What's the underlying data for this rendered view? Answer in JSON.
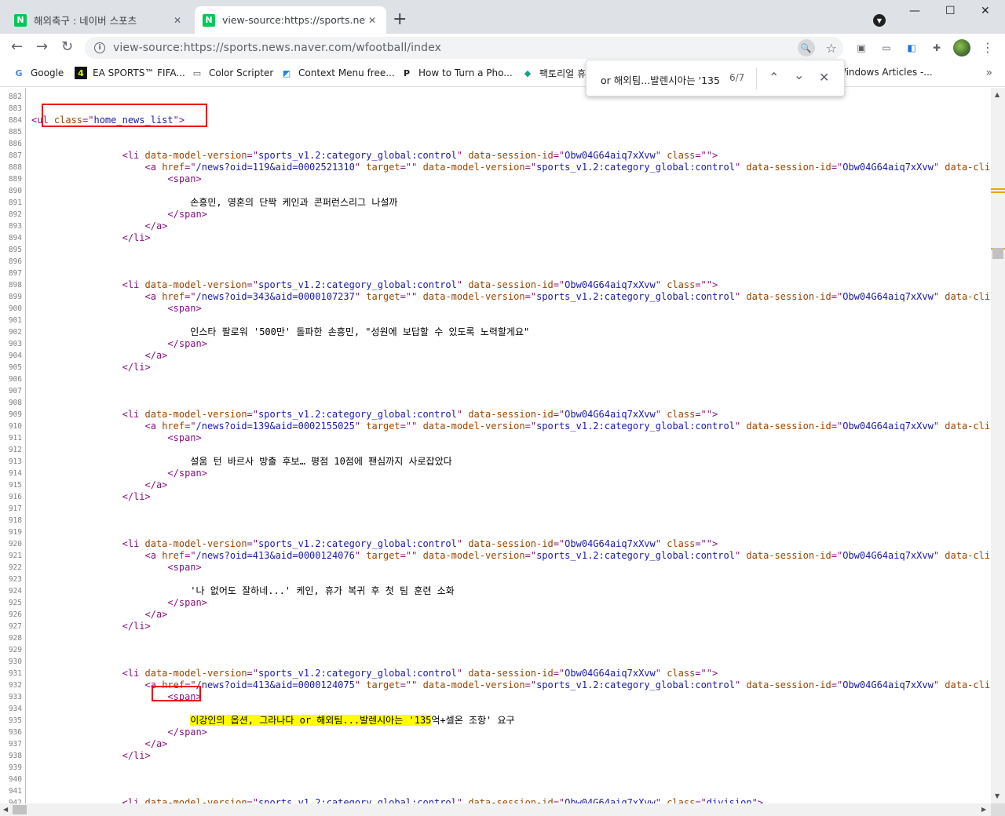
{
  "tabs": [
    {
      "title": "해외축구 : 네이버 스포츠",
      "favicon": "N"
    },
    {
      "title": "view-source:https://sports.news.",
      "favicon": "N"
    }
  ],
  "toolbar": {
    "url_prefix": "view-source:",
    "url_main": "https://sports.news.naver.com/wfootball/index"
  },
  "bookmarks": [
    {
      "label": "Google",
      "icon": "G"
    },
    {
      "label": "EA SPORTS™ FIFA...",
      "icon": "4"
    },
    {
      "label": "Color Scripter",
      "icon": "▭"
    },
    {
      "label": "Context Menu free...",
      "icon": "◩"
    },
    {
      "label": "How to Turn a Pho...",
      "icon": "P"
    },
    {
      "label": "팩토리얼 휴",
      "icon": "◆"
    },
    {
      "label": "Windows Articles -...",
      "icon": ""
    }
  ],
  "find": {
    "query": "or 해외팀...발렌시아는 '135",
    "count": "6/7"
  },
  "lines": [
    {
      "n": "882",
      "c": []
    },
    {
      "n": "883",
      "c": []
    },
    {
      "n": "884",
      "c": [
        [
          "tag",
          "<ul "
        ],
        [
          "attr",
          "class"
        ],
        [
          "tag",
          "=\""
        ],
        [
          "val",
          "home_news_list"
        ],
        [
          "tag",
          "\">"
        ]
      ]
    },
    {
      "n": "885",
      "c": []
    },
    {
      "n": "886",
      "c": []
    },
    {
      "n": "887",
      "c": [
        [
          "txt",
          "                "
        ],
        [
          "tag",
          "<li "
        ],
        [
          "attr",
          "data-model-version"
        ],
        [
          "tag",
          "=\""
        ],
        [
          "val",
          "sports_v1.2:category_global:control"
        ],
        [
          "tag",
          "\" "
        ],
        [
          "attr",
          "data-session-id"
        ],
        [
          "tag",
          "=\""
        ],
        [
          "val",
          "Obw04G64aiq7xXvw"
        ],
        [
          "tag",
          "\" "
        ],
        [
          "attr",
          "class"
        ],
        [
          "tag",
          "=\"\">"
        ]
      ]
    },
    {
      "n": "888",
      "c": [
        [
          "txt",
          "                    "
        ],
        [
          "tag",
          "<a "
        ],
        [
          "attr",
          "href"
        ],
        [
          "tag",
          "=\""
        ],
        [
          "val",
          "/news?oid=119&aid=0002521310"
        ],
        [
          "tag",
          "\" "
        ],
        [
          "attr",
          "target"
        ],
        [
          "tag",
          "=\"\" "
        ],
        [
          "attr",
          "data-model-version"
        ],
        [
          "tag",
          "=\""
        ],
        [
          "val",
          "sports_v1.2:category_global:control"
        ],
        [
          "tag",
          "\" "
        ],
        [
          "attr",
          "data-session-id"
        ],
        [
          "tag",
          "=\""
        ],
        [
          "val",
          "Obw04G64aiq7xXvw"
        ],
        [
          "tag",
          "\" "
        ],
        [
          "attr",
          "data-clickcode"
        ]
      ]
    },
    {
      "n": "889",
      "c": [
        [
          "txt",
          "                        "
        ],
        [
          "tag",
          "<span>"
        ]
      ]
    },
    {
      "n": "890",
      "c": []
    },
    {
      "n": "891",
      "c": [
        [
          "txt",
          "                            손흥민, 영혼의 단짝 케인과 콘퍼런스리그 나설까"
        ]
      ]
    },
    {
      "n": "892",
      "c": [
        [
          "txt",
          "                        "
        ],
        [
          "tag",
          "</span>"
        ]
      ]
    },
    {
      "n": "893",
      "c": [
        [
          "txt",
          "                    "
        ],
        [
          "tag",
          "</a>"
        ]
      ]
    },
    {
      "n": "894",
      "c": [
        [
          "txt",
          "                "
        ],
        [
          "tag",
          "</li>"
        ]
      ]
    },
    {
      "n": "895",
      "c": []
    },
    {
      "n": "896",
      "c": []
    },
    {
      "n": "897",
      "c": []
    },
    {
      "n": "898",
      "c": [
        [
          "txt",
          "                "
        ],
        [
          "tag",
          "<li "
        ],
        [
          "attr",
          "data-model-version"
        ],
        [
          "tag",
          "=\""
        ],
        [
          "val",
          "sports_v1.2:category_global:control"
        ],
        [
          "tag",
          "\" "
        ],
        [
          "attr",
          "data-session-id"
        ],
        [
          "tag",
          "=\""
        ],
        [
          "val",
          "Obw04G64aiq7xXvw"
        ],
        [
          "tag",
          "\" "
        ],
        [
          "attr",
          "class"
        ],
        [
          "tag",
          "=\"\">"
        ]
      ]
    },
    {
      "n": "899",
      "c": [
        [
          "txt",
          "                    "
        ],
        [
          "tag",
          "<a "
        ],
        [
          "attr",
          "href"
        ],
        [
          "tag",
          "=\""
        ],
        [
          "val",
          "/news?oid=343&aid=0000107237"
        ],
        [
          "tag",
          "\" "
        ],
        [
          "attr",
          "target"
        ],
        [
          "tag",
          "=\"\" "
        ],
        [
          "attr",
          "data-model-version"
        ],
        [
          "tag",
          "=\""
        ],
        [
          "val",
          "sports_v1.2:category_global:control"
        ],
        [
          "tag",
          "\" "
        ],
        [
          "attr",
          "data-session-id"
        ],
        [
          "tag",
          "=\""
        ],
        [
          "val",
          "Obw04G64aiq7xXvw"
        ],
        [
          "tag",
          "\" "
        ],
        [
          "attr",
          "data-clickcode"
        ]
      ]
    },
    {
      "n": "900",
      "c": [
        [
          "txt",
          "                        "
        ],
        [
          "tag",
          "<span>"
        ]
      ]
    },
    {
      "n": "901",
      "c": []
    },
    {
      "n": "902",
      "c": [
        [
          "txt",
          "                            인스타 팔로워 '500만' 돌파한 손흥민, \"성원에 보답할 수 있도록 노력할게요\""
        ]
      ]
    },
    {
      "n": "903",
      "c": [
        [
          "txt",
          "                        "
        ],
        [
          "tag",
          "</span>"
        ]
      ]
    },
    {
      "n": "904",
      "c": [
        [
          "txt",
          "                    "
        ],
        [
          "tag",
          "</a>"
        ]
      ]
    },
    {
      "n": "905",
      "c": [
        [
          "txt",
          "                "
        ],
        [
          "tag",
          "</li>"
        ]
      ]
    },
    {
      "n": "906",
      "c": []
    },
    {
      "n": "907",
      "c": []
    },
    {
      "n": "908",
      "c": []
    },
    {
      "n": "909",
      "c": [
        [
          "txt",
          "                "
        ],
        [
          "tag",
          "<li "
        ],
        [
          "attr",
          "data-model-version"
        ],
        [
          "tag",
          "=\""
        ],
        [
          "val",
          "sports_v1.2:category_global:control"
        ],
        [
          "tag",
          "\" "
        ],
        [
          "attr",
          "data-session-id"
        ],
        [
          "tag",
          "=\""
        ],
        [
          "val",
          "Obw04G64aiq7xXvw"
        ],
        [
          "tag",
          "\" "
        ],
        [
          "attr",
          "class"
        ],
        [
          "tag",
          "=\"\">"
        ]
      ]
    },
    {
      "n": "910",
      "c": [
        [
          "txt",
          "                    "
        ],
        [
          "tag",
          "<a "
        ],
        [
          "attr",
          "href"
        ],
        [
          "tag",
          "=\""
        ],
        [
          "val",
          "/news?oid=139&aid=0002155025"
        ],
        [
          "tag",
          "\" "
        ],
        [
          "attr",
          "target"
        ],
        [
          "tag",
          "=\"\" "
        ],
        [
          "attr",
          "data-model-version"
        ],
        [
          "tag",
          "=\""
        ],
        [
          "val",
          "sports_v1.2:category_global:control"
        ],
        [
          "tag",
          "\" "
        ],
        [
          "attr",
          "data-session-id"
        ],
        [
          "tag",
          "=\""
        ],
        [
          "val",
          "Obw04G64aiq7xXvw"
        ],
        [
          "tag",
          "\" "
        ],
        [
          "attr",
          "data-clickcode"
        ]
      ]
    },
    {
      "n": "911",
      "c": [
        [
          "txt",
          "                        "
        ],
        [
          "tag",
          "<span>"
        ]
      ]
    },
    {
      "n": "912",
      "c": []
    },
    {
      "n": "913",
      "c": [
        [
          "txt",
          "                            설움 턴 바르사 방출 후보… 평점 10점에 팬심까지 사로잡았다"
        ]
      ]
    },
    {
      "n": "914",
      "c": [
        [
          "txt",
          "                        "
        ],
        [
          "tag",
          "</span>"
        ]
      ]
    },
    {
      "n": "915",
      "c": [
        [
          "txt",
          "                    "
        ],
        [
          "tag",
          "</a>"
        ]
      ]
    },
    {
      "n": "916",
      "c": [
        [
          "txt",
          "                "
        ],
        [
          "tag",
          "</li>"
        ]
      ]
    },
    {
      "n": "917",
      "c": []
    },
    {
      "n": "918",
      "c": []
    },
    {
      "n": "919",
      "c": []
    },
    {
      "n": "920",
      "c": [
        [
          "txt",
          "                "
        ],
        [
          "tag",
          "<li "
        ],
        [
          "attr",
          "data-model-version"
        ],
        [
          "tag",
          "=\""
        ],
        [
          "val",
          "sports_v1.2:category_global:control"
        ],
        [
          "tag",
          "\" "
        ],
        [
          "attr",
          "data-session-id"
        ],
        [
          "tag",
          "=\""
        ],
        [
          "val",
          "Obw04G64aiq7xXvw"
        ],
        [
          "tag",
          "\" "
        ],
        [
          "attr",
          "class"
        ],
        [
          "tag",
          "=\"\">"
        ]
      ]
    },
    {
      "n": "921",
      "c": [
        [
          "txt",
          "                    "
        ],
        [
          "tag",
          "<a "
        ],
        [
          "attr",
          "href"
        ],
        [
          "tag",
          "=\""
        ],
        [
          "val",
          "/news?oid=413&aid=0000124076"
        ],
        [
          "tag",
          "\" "
        ],
        [
          "attr",
          "target"
        ],
        [
          "tag",
          "=\"\" "
        ],
        [
          "attr",
          "data-model-version"
        ],
        [
          "tag",
          "=\""
        ],
        [
          "val",
          "sports_v1.2:category_global:control"
        ],
        [
          "tag",
          "\" "
        ],
        [
          "attr",
          "data-session-id"
        ],
        [
          "tag",
          "=\""
        ],
        [
          "val",
          "Obw04G64aiq7xXvw"
        ],
        [
          "tag",
          "\" "
        ],
        [
          "attr",
          "data-clickcode"
        ]
      ]
    },
    {
      "n": "922",
      "c": [
        [
          "txt",
          "                        "
        ],
        [
          "tag",
          "<span>"
        ]
      ]
    },
    {
      "n": "923",
      "c": []
    },
    {
      "n": "924",
      "c": [
        [
          "txt",
          "                            '나 없어도 잘하네...' 케인, 휴가 복귀 후 첫 팀 훈련 소화"
        ]
      ]
    },
    {
      "n": "925",
      "c": [
        [
          "txt",
          "                        "
        ],
        [
          "tag",
          "</span>"
        ]
      ]
    },
    {
      "n": "926",
      "c": [
        [
          "txt",
          "                    "
        ],
        [
          "tag",
          "</a>"
        ]
      ]
    },
    {
      "n": "927",
      "c": [
        [
          "txt",
          "                "
        ],
        [
          "tag",
          "</li>"
        ]
      ]
    },
    {
      "n": "928",
      "c": []
    },
    {
      "n": "929",
      "c": []
    },
    {
      "n": "930",
      "c": []
    },
    {
      "n": "931",
      "c": [
        [
          "txt",
          "                "
        ],
        [
          "tag",
          "<li "
        ],
        [
          "attr",
          "data-model-version"
        ],
        [
          "tag",
          "=\""
        ],
        [
          "val",
          "sports_v1.2:category_global:control"
        ],
        [
          "tag",
          "\" "
        ],
        [
          "attr",
          "data-session-id"
        ],
        [
          "tag",
          "=\""
        ],
        [
          "val",
          "Obw04G64aiq7xXvw"
        ],
        [
          "tag",
          "\" "
        ],
        [
          "attr",
          "class"
        ],
        [
          "tag",
          "=\"\">"
        ]
      ]
    },
    {
      "n": "932",
      "c": [
        [
          "txt",
          "                    "
        ],
        [
          "tag",
          "<a "
        ],
        [
          "attr",
          "href"
        ],
        [
          "tag",
          "=\""
        ],
        [
          "val",
          "/news?oid=413&aid=0000124075"
        ],
        [
          "tag",
          "\" "
        ],
        [
          "attr",
          "target"
        ],
        [
          "tag",
          "=\"\" "
        ],
        [
          "attr",
          "data-model-version"
        ],
        [
          "tag",
          "=\""
        ],
        [
          "val",
          "sports_v1.2:category_global:control"
        ],
        [
          "tag",
          "\" "
        ],
        [
          "attr",
          "data-session-id"
        ],
        [
          "tag",
          "=\""
        ],
        [
          "val",
          "Obw04G64aiq7xXvw"
        ],
        [
          "tag",
          "\" "
        ],
        [
          "attr",
          "data-clickcode"
        ]
      ]
    },
    {
      "n": "933",
      "c": [
        [
          "txt",
          "                        "
        ],
        [
          "tag",
          "<span>"
        ]
      ]
    },
    {
      "n": "934",
      "c": []
    },
    {
      "n": "935",
      "c": [
        [
          "txt",
          "                            "
        ],
        [
          "hl",
          "이강인의 옵션, 그라나다 or 해외팀...발렌시아는 '135"
        ],
        [
          "txt",
          "억+셀온 조항' 요구"
        ]
      ]
    },
    {
      "n": "936",
      "c": [
        [
          "txt",
          "                        "
        ],
        [
          "tag",
          "</span>"
        ]
      ]
    },
    {
      "n": "937",
      "c": [
        [
          "txt",
          "                    "
        ],
        [
          "tag",
          "</a>"
        ]
      ]
    },
    {
      "n": "938",
      "c": [
        [
          "txt",
          "                "
        ],
        [
          "tag",
          "</li>"
        ]
      ]
    },
    {
      "n": "939",
      "c": []
    },
    {
      "n": "940",
      "c": []
    },
    {
      "n": "941",
      "c": []
    },
    {
      "n": "942",
      "c": [
        [
          "txt",
          "                "
        ],
        [
          "tag",
          "<li "
        ],
        [
          "attr",
          "data-model-version"
        ],
        [
          "tag",
          "=\""
        ],
        [
          "val",
          "sports_v1.2:category_global:control"
        ],
        [
          "tag",
          "\" "
        ],
        [
          "attr",
          "data-session-id"
        ],
        [
          "tag",
          "=\""
        ],
        [
          "val",
          "Obw04G64aiq7xXvw"
        ],
        [
          "tag",
          "\" "
        ],
        [
          "attr",
          "class"
        ],
        [
          "tag",
          "=\""
        ],
        [
          "val",
          "division"
        ],
        [
          "tag",
          "\">"
        ]
      ]
    }
  ],
  "colors": {
    "tag": "#881280",
    "attr": "#994500",
    "value": "#1a1aa6",
    "highlight": "#ffff00",
    "annotation_box": "#e00000"
  }
}
